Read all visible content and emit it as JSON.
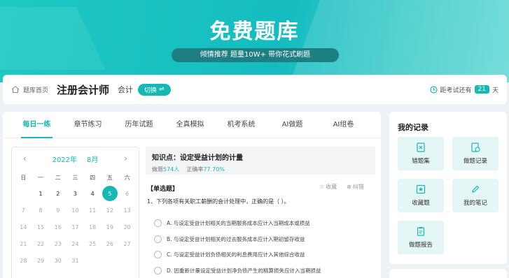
{
  "banner": {
    "title": "免费题库",
    "slogan": "倾情推荐 题量10W+ 带你花式刷题"
  },
  "topbar": {
    "crumb": "题库首页",
    "exam": "注册会计师",
    "subject": "会计",
    "switch_label": "切换",
    "switch_icon": "⇌",
    "countdown_prefix": "距考试还有",
    "days": "21",
    "days_unit": "天"
  },
  "tabs": [
    "每日一练",
    "章节练习",
    "历年试题",
    "全真模拟",
    "机考系统",
    "AI做题",
    "AI组卷"
  ],
  "calendar": {
    "year": "2022年",
    "month": "8月",
    "weekdays": [
      "日",
      "一",
      "二",
      "三",
      "四",
      "五",
      "六"
    ],
    "weeks": [
      [
        "",
        "1",
        "2",
        "3",
        "4",
        "5",
        "6"
      ],
      [
        "7",
        "8",
        "9",
        "10",
        "11",
        "12",
        "13"
      ],
      [
        "14",
        "15",
        "16",
        "17",
        "18",
        "19",
        "20"
      ],
      [
        "21",
        "22",
        "23",
        "24",
        "25",
        "26",
        "27"
      ],
      [
        "28",
        "29",
        "30",
        "31",
        "",
        "",
        ""
      ]
    ],
    "today": "5",
    "active_days": [
      "1",
      "2",
      "3",
      "4"
    ]
  },
  "knowledge": {
    "title": "知识点：设定受益计划的计量",
    "done_label": "做题",
    "done_count": "574人",
    "accuracy_label": "正确率",
    "accuracy": "77.70%"
  },
  "question": {
    "type": "【单选题】",
    "fav": "收藏",
    "report": "纠错",
    "text": "1、下列各项有关职工薪酬的会计处理中，正确的是（ ）。",
    "options": [
      "A. 与设定受益计划相关的当期服务成本应计入当期成本或损益",
      "B. 与设定受益计划相关的过去服务成本应计入期初留存收益",
      "C. 与设定受益计划负债相关的利息费用应计入其他综合收益",
      "D. 因重新计量设定受益计划净负债产生的精算损失应计入当期损益"
    ]
  },
  "records": {
    "title": "我的记录",
    "items": [
      "错题集",
      "做题记录",
      "收藏题",
      "我的笔记",
      "做题报告"
    ]
  },
  "colors": {
    "accent": "#16b8b4",
    "banner": "#1fc9c3"
  }
}
